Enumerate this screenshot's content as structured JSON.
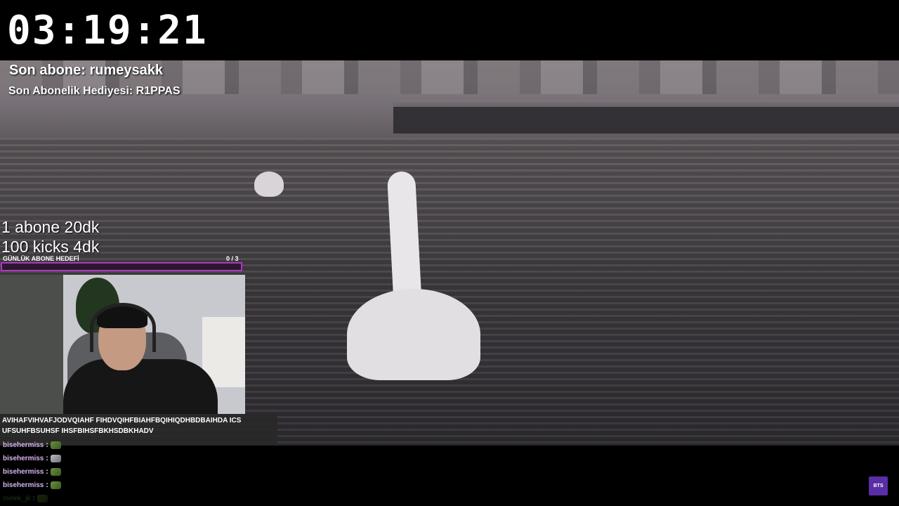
{
  "clock": "03:19:21",
  "subscriber": {
    "last_sub": "Son abone: rumeysakk",
    "last_gift": "Son Abonelik Hediyesi: R1PPAS"
  },
  "goals": [
    "1 abone 20dk",
    "100 kicks 4dk"
  ],
  "daily_goal": {
    "label": "GÜNLÜK ABONE HEDEFİ",
    "count": "0  / 3",
    "progress": 0,
    "color": "#b235c2"
  },
  "ticker": {
    "line1": "AVIHAFVIHVAFJODVQIAHF FIHDVQIHFBIAHFBQIHIQDHBDBAIHDA ICS",
    "line2": "UFSUHFBSUHSF IHSFBIHSFBKHSDBKHADV"
  },
  "chat": [
    {
      "user": "bisehermiss",
      "sep": ":",
      "emote": "turtle-emote"
    },
    {
      "user": "bisehermiss",
      "sep": ":",
      "emote": "cat-emote"
    },
    {
      "user": "bisehermiss",
      "sep": ":",
      "emote": "turtle-emote"
    },
    {
      "user": "bisehermiss",
      "sep": ":",
      "emote": "turtle-emote"
    },
    {
      "user": "melek_jk",
      "sep": ":",
      "emote": "turtle-emote"
    }
  ],
  "badge": "BTS"
}
